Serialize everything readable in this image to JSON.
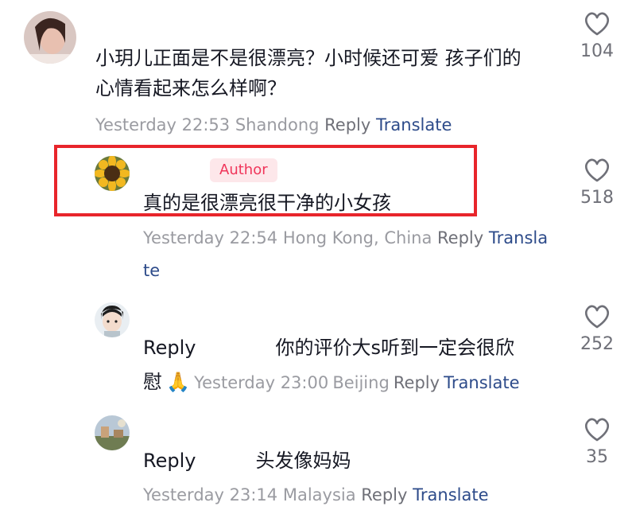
{
  "colors": {
    "highlight": "#e8252b",
    "author_badge_bg": "#fde7ea",
    "author_badge_text": "#f0355a",
    "translate_link": "#2d4b8a",
    "meta_text": "#9a9ba1"
  },
  "comments": [
    {
      "text_line1": "小玥儿正面是不是很漂亮？小时候还可爱 孩子们的",
      "text_line2": "心情看起来怎么样啊？",
      "time": "Yesterday 22:53",
      "location": "Shandong",
      "reply_label": "Reply",
      "translate_label": "Translate",
      "likes": "104",
      "icons": [
        "avatar",
        "heart-outline-icon"
      ]
    },
    {
      "author_badge": "Author",
      "text": "真的是很漂亮很干净的小女孩",
      "time": "Yesterday 22:54",
      "location": "Hong Kong, China",
      "reply_label": "Reply",
      "translate_label_part1": "Transla",
      "translate_label_part2": "te",
      "likes": "518",
      "icons": [
        "sunflower-avatar",
        "heart-outline-icon"
      ]
    },
    {
      "reply_prefix": "Reply",
      "text_line1": "你的评价大s听到一定会很欣",
      "text_line2": "慰",
      "emoji": "🙏",
      "time": "Yesterday 23:00",
      "location": "Beijing",
      "reply_label": "Reply",
      "translate_label": "Translate",
      "likes": "252",
      "icons": [
        "cartoon-avatar",
        "heart-outline-icon"
      ]
    },
    {
      "reply_prefix": "Reply",
      "text": "头发像妈妈",
      "time": "Yesterday 23:14",
      "location": "Malaysia",
      "reply_label": "Reply",
      "translate_label": "Translate",
      "likes": "35",
      "icons": [
        "landscape-avatar",
        "heart-outline-icon"
      ]
    }
  ]
}
